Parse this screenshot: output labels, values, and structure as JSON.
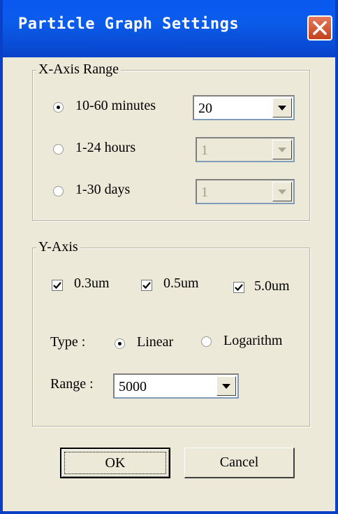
{
  "window": {
    "title": "Particle Graph Settings"
  },
  "xaxis": {
    "legend": "X-Axis Range",
    "options": [
      {
        "label": "10-60 minutes",
        "checked": true,
        "combo_value": "20",
        "enabled": true
      },
      {
        "label": "1-24 hours",
        "checked": false,
        "combo_value": "1",
        "enabled": false
      },
      {
        "label": "1-30 days",
        "checked": false,
        "combo_value": "1",
        "enabled": false
      }
    ]
  },
  "yaxis": {
    "legend": "Y-Axis",
    "checkboxes": [
      {
        "label": "0.3um",
        "checked": true
      },
      {
        "label": "0.5um",
        "checked": true
      },
      {
        "label": "5.0um",
        "checked": true
      }
    ],
    "type_label": "Type :",
    "type_options": [
      {
        "label": "Linear",
        "checked": true
      },
      {
        "label": "Logarithm",
        "checked": false
      }
    ],
    "range_label": "Range :",
    "range_value": "5000"
  },
  "buttons": {
    "ok": "OK",
    "cancel": "Cancel"
  },
  "colors": {
    "titlebar": "#0a58f0",
    "face": "#ece9d8",
    "close": "#c3411d"
  }
}
